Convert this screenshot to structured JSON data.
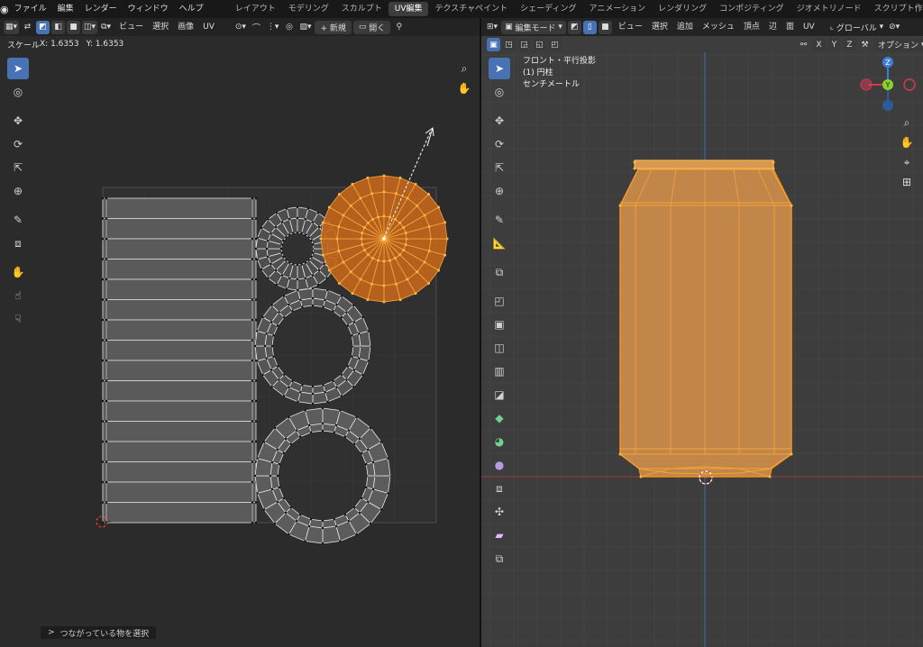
{
  "menu": {
    "items": [
      "ファイル",
      "編集",
      "レンダー",
      "ウィンドウ",
      "ヘルプ"
    ]
  },
  "workspaces": {
    "tabs": [
      "レイアウト",
      "モデリング",
      "スカルプト",
      "UV編集",
      "テクスチャペイント",
      "シェーディング",
      "アニメーション",
      "レンダリング",
      "コンポジティング",
      "ジオメトリノード",
      "スクリプト作成"
    ],
    "active_index": 3,
    "add": "+"
  },
  "uv_editor": {
    "header": {
      "menus": [
        "ビュー",
        "選択",
        "画像",
        "UV"
      ],
      "new_label": "+ 新規",
      "open_label": "開く"
    },
    "scale_label": "スケール",
    "scale_x_label": "X: 1.6353",
    "scale_y_label": "Y: 1.6353",
    "status_label": "つながっている物を選択",
    "status_chevron": ">"
  },
  "viewport": {
    "header": {
      "mode_label": "編集モード",
      "menus": [
        "ビュー",
        "選択",
        "追加",
        "メッシュ",
        "頂点",
        "辺",
        "面",
        "UV"
      ],
      "transform_label": "グローバル",
      "axis_x": "X",
      "axis_y": "Y",
      "axis_z": "Z",
      "options_label": "オプション"
    },
    "overlay": {
      "view_name": "フロント・平行投影",
      "object_name": "(1) 円柱",
      "units": "センチメートル"
    },
    "gizmo": {
      "z_label": "Z",
      "y_label": "Y",
      "x_color": "#d5394f",
      "y_color": "#8bd12d",
      "z_color": "#3d7ed8"
    }
  },
  "colors": {
    "accent": "#4772b3",
    "selection_orange": "#f0901a",
    "mesh_fill": "#c98a4a"
  }
}
